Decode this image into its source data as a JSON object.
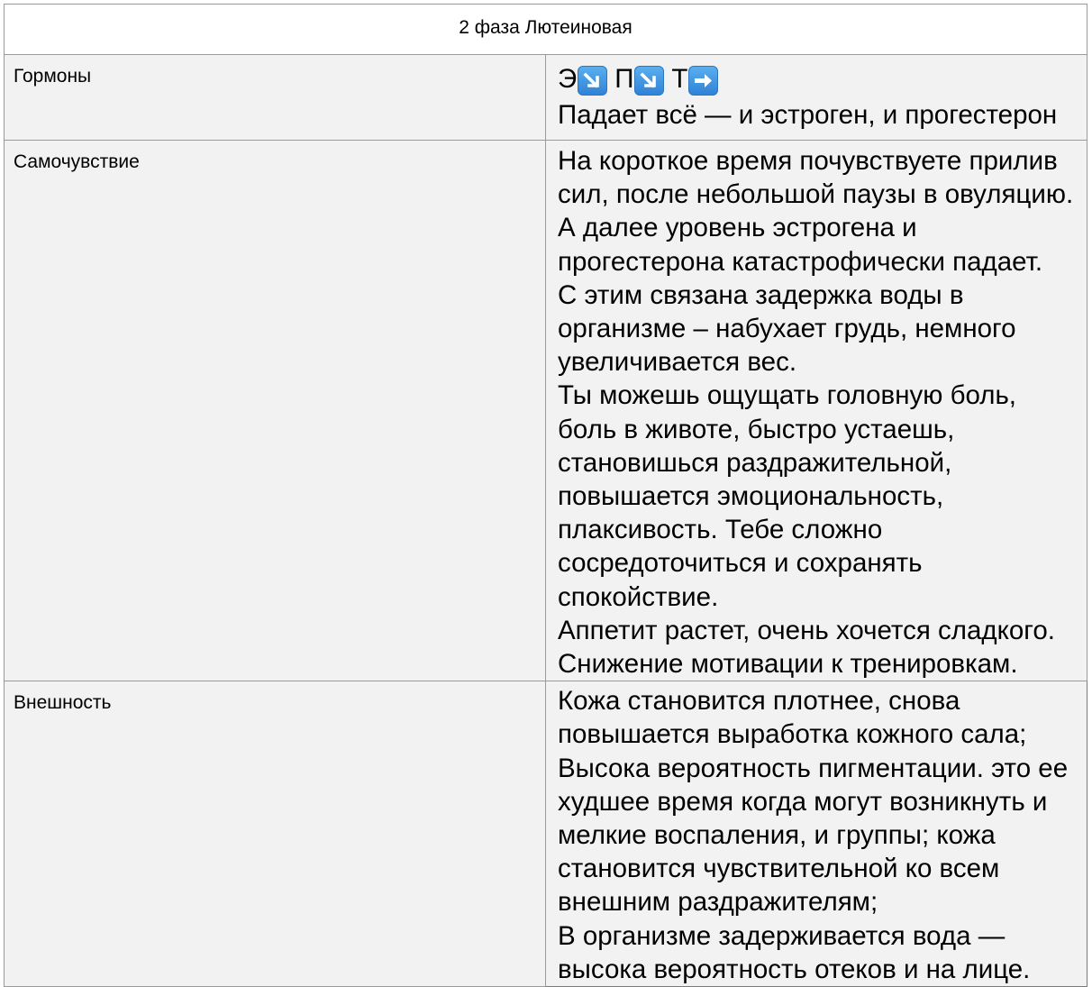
{
  "document": {
    "title": "2 фаза Лютеиновая",
    "rows": [
      {
        "label": "Гормоны",
        "hormones": [
          {
            "letter": "Э",
            "trend_icon": "arrow-down-right-icon"
          },
          {
            "letter": "П",
            "trend_icon": "arrow-down-right-icon"
          },
          {
            "letter": "Т",
            "trend_icon": "arrow-right-icon"
          }
        ],
        "paragraphs": [
          "Падает всё — и эстроген, и прогестерон"
        ]
      },
      {
        "label": "Самочувствие",
        "paragraphs": [
          "На короткое время почувствуете прилив сил, после небольшой паузы в овуляцию. А далее уровень эстрогена и прогестерона катастрофически падает.",
          "С этим связана задержка воды в организме – набухает грудь, немного увеличивается вес.",
          "Ты можешь ощущать головную боль, боль в животе, быстро устаешь, становишься раздражительной, повышается эмоциональность, плаксивость. Тебе сложно сосредоточиться и сохранять спокойствие.",
          "Аппетит растет, очень хочется сладкого. Снижение мотивации к тренировкам."
        ]
      },
      {
        "label": "Внешность",
        "paragraphs": [
          "Кожа становится плотнее, снова повышается выработка кожного сала;",
          "Высока вероятность пигментации. это ее худшее время когда могут возникнуть и мелкие воспаления, и группы; кожа становится чувствительной ко всем внешним раздражителям;",
          "В организме задерживается вода — высока вероятность отеков и на лице."
        ]
      }
    ],
    "colors": {
      "cell_background": "#f2f2f2",
      "border": "#9a9a9a",
      "icon_blue": "#3c8fe0"
    }
  }
}
